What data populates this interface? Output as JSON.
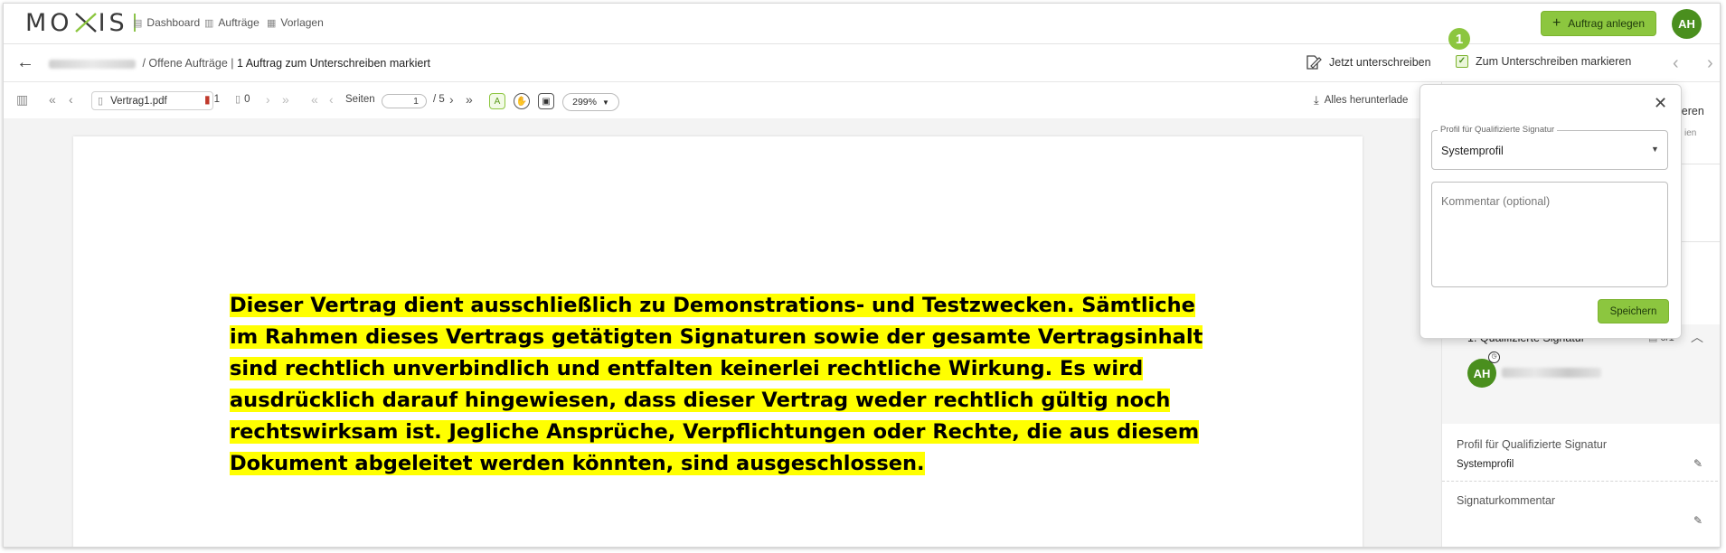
{
  "app": {
    "logo_text_left": "MO",
    "logo_text_right": "IS",
    "nav": {
      "dashboard": "Dashboard",
      "orders": "Aufträge",
      "templates": "Vorlagen"
    },
    "new_order_button": "Auftrag anlegen",
    "user_initials": "AH"
  },
  "breadcrumb": {
    "section": "/ Offene Aufträge |",
    "current": "1 Auftrag zum Unterschreiben markiert"
  },
  "actions": {
    "sign_now": "Jetzt unterschreiben",
    "mark_for_signing": "Zum Unterschreiben markieren",
    "step_number": "1"
  },
  "toolbar": {
    "filename": "Vertrag1.pdf",
    "signature_count": "1",
    "attachment_count": "0",
    "pages_label": "Seiten",
    "current_page": "1",
    "total_pages": "/ 5",
    "zoom": "299%",
    "download_all": "Alles herunterlade"
  },
  "document": {
    "text": "Dieser Vertrag dient ausschließlich zu Demonstrations- und Testzwecken. Sämtliche im Rahmen dieses Vertrags getätigten Signaturen sowie der gesamte Vertragsinhalt sind rechtlich unverbindlich und entfalten keinerlei rechtliche Wirkung. Es wird ausdrücklich darauf hingewiesen, dass dieser Vertrag weder rechtlich gültig noch rechtswirksam ist. Jegliche Ansprüche, Verpflichtungen oder Rechte, die aus diesem Dokument abgeleitet werden könnten, sind ausgeschlossen."
  },
  "right_panel": {
    "fragment_top": "ieren",
    "fragment_sub": "ien",
    "signature_step": "1. Qualifizierte Signatur",
    "signature_progress": "0/1",
    "signer_initials": "AH",
    "profile_label": "Profil für Qualifizierte Signatur",
    "profile_value": "Systemprofil",
    "comment_label": "Signaturkommentar"
  },
  "popover": {
    "profile_legend": "Profil für Qualifizierte Signatur",
    "profile_value": "Systemprofil",
    "comment_placeholder": "Kommentar (optional)",
    "save_button": "Speichern"
  },
  "colors": {
    "accent": "#8cc63f",
    "avatar": "#4a8f1e",
    "highlight": "#ffff00"
  }
}
